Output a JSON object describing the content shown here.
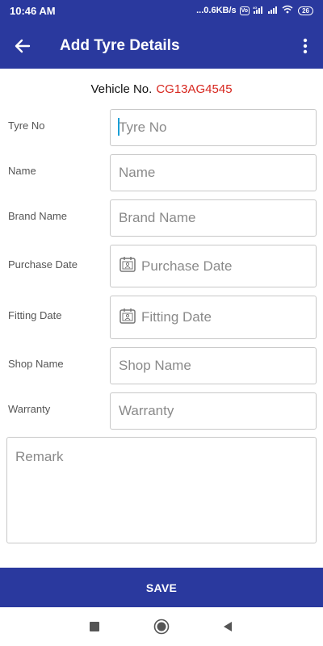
{
  "status_bar": {
    "time": "10:46 AM",
    "network_speed": "...0.6KB/s",
    "vo_badge": "Vo",
    "lte_badge": "4G",
    "battery": "26"
  },
  "app_bar": {
    "title": "Add Tyre Details",
    "back_icon": "arrow-left-icon",
    "menu_icon": "more-vertical-icon"
  },
  "vehicle": {
    "label": "Vehicle No.",
    "value": "CG13AG4545",
    "value_color": "#d7261e"
  },
  "form": {
    "tyre_no": {
      "label": "Tyre No",
      "placeholder": "Tyre No",
      "value": ""
    },
    "name": {
      "label": "Name",
      "placeholder": "Name",
      "value": ""
    },
    "brand_name": {
      "label": "Brand Name",
      "placeholder": "Brand Name",
      "value": ""
    },
    "purchase_date": {
      "label": "Purchase Date",
      "placeholder": "Purchase Date",
      "value": "",
      "icon": "calendar-icon"
    },
    "fitting_date": {
      "label": "Fitting Date",
      "placeholder": "Fitting Date",
      "value": "",
      "icon": "calendar-icon"
    },
    "shop_name": {
      "label": "Shop Name",
      "placeholder": "Shop Name",
      "value": ""
    },
    "warranty": {
      "label": "Warranty",
      "placeholder": "Warranty",
      "value": ""
    },
    "remark": {
      "placeholder": "Remark",
      "value": ""
    }
  },
  "save_button": {
    "label": "SAVE"
  },
  "nav_bar": {
    "recents_icon": "square-icon",
    "home_icon": "circle-icon",
    "back_icon": "triangle-back-icon"
  },
  "colors": {
    "primary": "#2a399e",
    "accent_cursor": "#1a9fd6",
    "vehicle_number": "#d7261e"
  }
}
